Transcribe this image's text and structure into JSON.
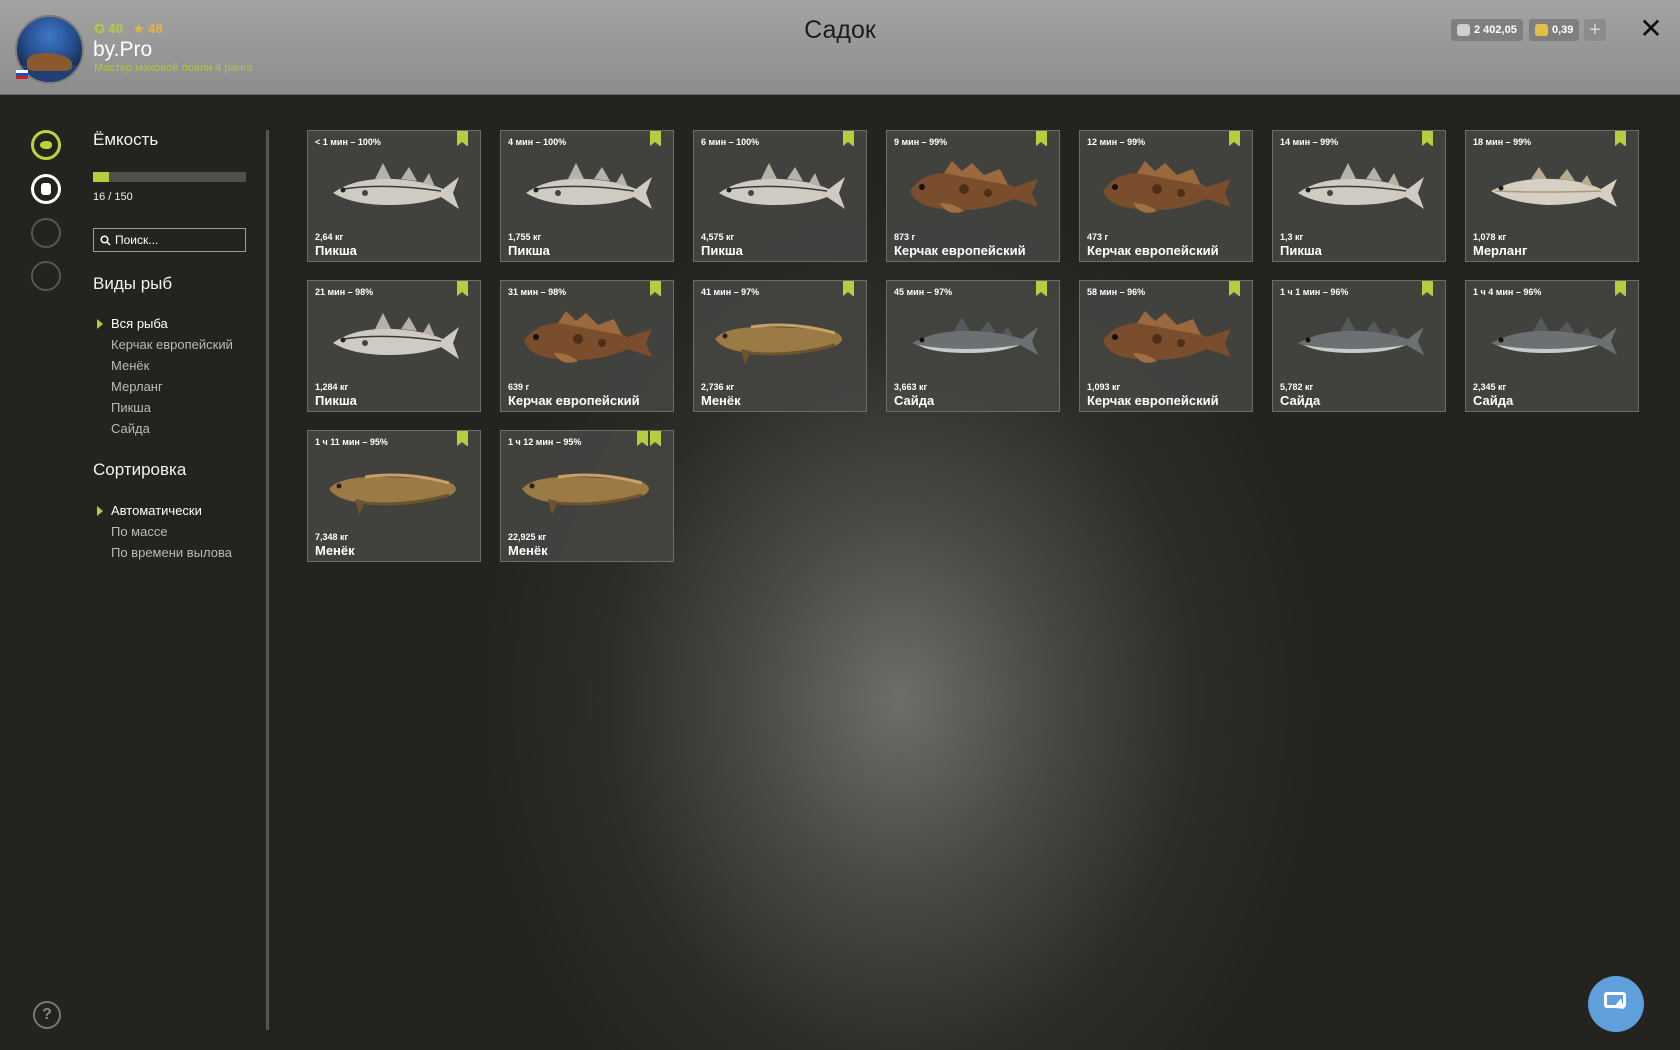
{
  "header": {
    "title": "Садок",
    "player": {
      "level": "40",
      "stars": "48",
      "name": "by.Pro",
      "rank": "Мастер маховой ловли 4 ранга"
    },
    "silver": "2 402,05",
    "gold": "0,39"
  },
  "capacity": {
    "title": "Ёмкость",
    "text": "16 / 150",
    "fraction": 0.107
  },
  "search": {
    "placeholder": "Поиск..."
  },
  "species": {
    "title": "Виды рыб",
    "items": [
      "Вся рыба",
      "Керчак европейский",
      "Менёк",
      "Мерланг",
      "Пикша",
      "Сайда"
    ],
    "active": 0
  },
  "sorting": {
    "title": "Сортировка",
    "items": [
      "Автоматически",
      "По массе",
      "По времени вылова"
    ],
    "active": 0
  },
  "colors": {
    "accent": "#b6cd3f",
    "close": "#111111",
    "cursor_button": "#5f9fdc"
  },
  "fish": [
    {
      "time": "< 1 мин – 100%",
      "weight": "2,64 кг",
      "name": "Пикша",
      "kind": "haddock",
      "flags": 1
    },
    {
      "time": "4 мин – 100%",
      "weight": "1,755 кг",
      "name": "Пикша",
      "kind": "haddock",
      "flags": 1
    },
    {
      "time": "6 мин – 100%",
      "weight": "4,575 кг",
      "name": "Пикша",
      "kind": "haddock",
      "flags": 1
    },
    {
      "time": "9 мин – 99%",
      "weight": "873 г",
      "name": "Керчак европейский",
      "kind": "sculpin",
      "flags": 1
    },
    {
      "time": "12 мин – 99%",
      "weight": "473 г",
      "name": "Керчак европейский",
      "kind": "sculpin",
      "flags": 1
    },
    {
      "time": "14 мин – 99%",
      "weight": "1,3 кг",
      "name": "Пикша",
      "kind": "haddock",
      "flags": 1
    },
    {
      "time": "18 мин – 99%",
      "weight": "1,078 кг",
      "name": "Мерланг",
      "kind": "whiting",
      "flags": 1
    },
    {
      "time": "21 мин – 98%",
      "weight": "1,284 кг",
      "name": "Пикша",
      "kind": "haddock",
      "flags": 1
    },
    {
      "time": "31 мин – 98%",
      "weight": "639 г",
      "name": "Керчак европейский",
      "kind": "sculpin",
      "flags": 1
    },
    {
      "time": "41 мин – 97%",
      "weight": "2,736 кг",
      "name": "Менёк",
      "kind": "tusk",
      "flags": 1
    },
    {
      "time": "45 мин – 97%",
      "weight": "3,663 кг",
      "name": "Сайда",
      "kind": "pollock",
      "flags": 1
    },
    {
      "time": "58 мин – 96%",
      "weight": "1,093 кг",
      "name": "Керчак европейский",
      "kind": "sculpin",
      "flags": 1
    },
    {
      "time": "1 ч 1 мин – 96%",
      "weight": "5,782 кг",
      "name": "Сайда",
      "kind": "pollock",
      "flags": 1
    },
    {
      "time": "1 ч 4 мин – 96%",
      "weight": "2,345 кг",
      "name": "Сайда",
      "kind": "pollock",
      "flags": 1
    },
    {
      "time": "1 ч 11 мин – 95%",
      "weight": "7,348 кг",
      "name": "Менёк",
      "kind": "tusk",
      "flags": 1
    },
    {
      "time": "1 ч 12 мин – 95%",
      "weight": "22,925 кг",
      "name": "Менёк",
      "kind": "tusk",
      "flags": 2
    }
  ]
}
